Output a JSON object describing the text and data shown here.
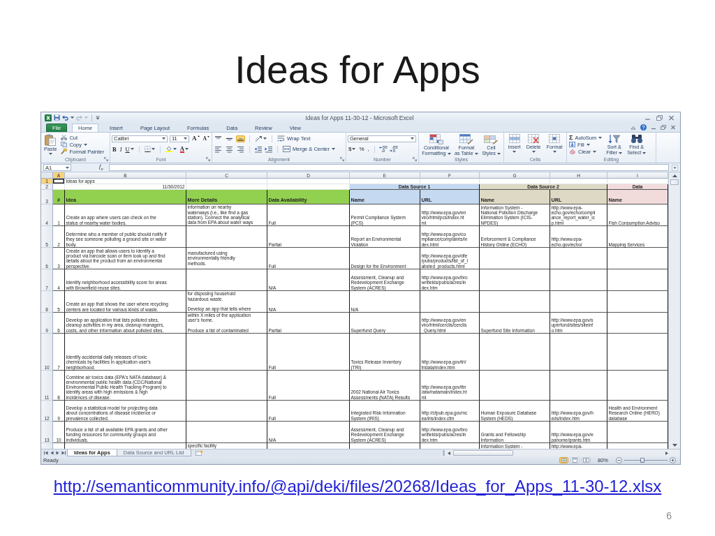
{
  "slide": {
    "title": "Ideas for Apps",
    "link": "http://semanticommunity.info/@api/deki/files/20268/Ideas_for_Apps_11-30-12.xlsx",
    "page_number": "6"
  },
  "window": {
    "title": "Ideas for Apps 11-30-12 - Microsoft Excel"
  },
  "quick_access": [
    {
      "kind": "save",
      "disabled": false
    },
    {
      "kind": "undo",
      "disabled": false
    },
    {
      "kind": "redo",
      "disabled": true
    }
  ],
  "ribbon_tabs": [
    {
      "label": "File",
      "kind": "file",
      "selected": false
    },
    {
      "label": "Home",
      "kind": "tab",
      "selected": true
    },
    {
      "label": "Insert",
      "kind": "tab",
      "selected": false
    },
    {
      "label": "Page Layout",
      "kind": "tab",
      "selected": false
    },
    {
      "label": "Formulas",
      "kind": "tab",
      "selected": false
    },
    {
      "label": "Data",
      "kind": "tab",
      "selected": false
    },
    {
      "label": "Review",
      "kind": "tab",
      "selected": false
    },
    {
      "label": "View",
      "kind": "tab",
      "selected": false
    }
  ],
  "ribbon_groups": [
    {
      "kind": "clipboard",
      "title": "Clipboard",
      "launcher": true,
      "paste": "Paste",
      "cut": "Cut",
      "copy": "Copy",
      "format_painter": "Format Painter"
    },
    {
      "kind": "font",
      "title": "Font",
      "launcher": true,
      "font_name": "Calibri",
      "font_size": "11",
      "grow": "A",
      "shrink": "A",
      "bold": "B",
      "italic": "I",
      "underline": "U",
      "font_color": "A"
    },
    {
      "kind": "alignment",
      "title": "Alignment",
      "launcher": true,
      "vertical_align": [
        {
          "selected": false
        },
        {
          "selected": false
        },
        {
          "selected": true
        }
      ],
      "wrap_text": "Wrap Text",
      "merge": "Merge & Center"
    },
    {
      "kind": "number",
      "title": "Number",
      "launcher": true,
      "format": "General",
      "currency": "$",
      "percent": "%",
      "comma": ","
    },
    {
      "kind": "styles",
      "title": "Styles",
      "buttons": [
        {
          "kind": "conditional",
          "label": "Conditional\nFormatting"
        },
        {
          "kind": "table",
          "label": "Format\nas Table"
        },
        {
          "kind": "cell_styles",
          "label": "Cell\nStyles"
        }
      ]
    },
    {
      "kind": "cells",
      "title": "Cells",
      "buttons": [
        {
          "kind": "insert",
          "label": "Insert"
        },
        {
          "kind": "delete",
          "label": "Delete"
        },
        {
          "kind": "format",
          "label": "Format"
        }
      ]
    },
    {
      "kind": "editing",
      "title": "Editing",
      "autosum_symbol": "Σ",
      "autosum": "AutoSum",
      "fill": "Fill",
      "clear": "Clear",
      "sort_filter": "Sort &\nFilter",
      "find_select": "Find &\nSelect"
    }
  ],
  "formula_bar": {
    "name_box": "A1",
    "function_label": "f$_{x}$"
  },
  "sheet": {
    "columns": [
      {
        "letter": "A",
        "selected": true
      },
      {
        "letter": "B",
        "selected": false
      },
      {
        "letter": "C",
        "selected": false
      },
      {
        "letter": "D",
        "selected": false
      },
      {
        "letter": "E",
        "selected": false
      },
      {
        "letter": "F",
        "selected": false
      },
      {
        "letter": "G",
        "selected": false
      },
      {
        "letter": "H",
        "selected": false
      },
      {
        "letter": "I",
        "selected": false
      }
    ],
    "title_row": {
      "row": "1",
      "selected": true,
      "title": "Ideas for apps"
    },
    "date_row": {
      "row": "2",
      "selected": false,
      "date": "11/30/2012"
    },
    "header_row": {
      "row": "3",
      "selected": false
    },
    "header_groups": [
      {
        "color": "#92d050",
        "columns": [
          "#",
          "Idea",
          "More Details",
          "Data Availability"
        ]
      },
      {
        "title": "Data Source 1",
        "color": "#c5d9f1",
        "columns": [
          "Name",
          "URL"
        ]
      },
      {
        "title": "Data Source 2",
        "color": "#ddd9c4",
        "columns": [
          "Name",
          "URL"
        ]
      },
      {
        "title": "Data",
        "color": "#f2dcdb",
        "columns": [
          "Name"
        ]
      }
    ],
    "rows": [
      {
        "row": "4",
        "selected": false,
        "number": "1",
        "idea": "Create an app where users can check on the\nstatus of nearby water bodies.",
        "details": "information on nearby\nwaterways (i.e., like find a gas\nstation). Connect the analytical\ndata from EPA about water ways",
        "availability": "Full",
        "source1_name": "Permit Compliance System\n(PCS)",
        "source1_url": "http://www.epa.gov/en\nviro/html/pcs/index.ht\nml",
        "source2_name": "Information System -\nNational Pollution Discharge\nElimination System (ICIS-\nNPDES)",
        "source2_url": "http://www.epa-\necho.gov/echo/compli\nance_report_water_ic\np.html",
        "source3_name": "Fish Consumption Adviso"
      },
      {
        "row": "5",
        "selected": false,
        "number": "2",
        "idea": "Determine who a member of public should notify if\nthey see someone polluting a ground site or water\nbody.",
        "availability": "Partial",
        "source1_name": "Report an Environmental\nViolation",
        "source1_url": "http://www.epa.gov/co\nmpliance/complaints/in\ndex.html",
        "source2_name": "Enforcement & Compliance\nHistory Online (ECHO)",
        "source2_url": "http://www.epa-\necho.gov/echo/",
        "source3_name": "Mapping Services"
      },
      {
        "row": "6",
        "selected": false,
        "number": "3",
        "idea": "Create an app that allows users to identify a\nproduct via barcode scan or item look up and find\ndetails about the product from an environmental\nperspective.",
        "details": "manufactured using\nenvironmentally friendly\nmethods.",
        "availability": "Full",
        "source1_name": "Design for the Environment",
        "source1_url": "http://www.epa.gov/dfe\n/pubs/products/list_of_l\nabeled_products.html"
      },
      {
        "row": "7",
        "selected": false,
        "number": "4",
        "idea": "Identify neighborhood accessibility score for areas\nwith Brownfield reuse sites.",
        "availability": "N/A",
        "source1_name": "Assessment, Cleanup and\nRedevelopment Exchange\nSystem (ACRES)",
        "source1_url": "http://www.epa.gov/bro\nwnfields/pubs/acres/in\ndex.htm"
      },
      {
        "row": "8",
        "selected": false,
        "number": "5",
        "idea": "Create an app that shows the user where recycling\ncenters are located for various kinds of waste.",
        "details": "for disposing household\nhazardous waste.\n\nDevelop an app that tells where",
        "availability": "N/A",
        "source1_name": "N/A"
      },
      {
        "row": "9",
        "selected": false,
        "number": "6",
        "idea": "Develop an application that lists polluted sites,\ncleanup activities in my area, cleanup managers,\ncosts, and other information about polluted sites.",
        "details": "within X miles of the application\nuser's home.\n\nProduce a list of contaminated",
        "availability": "Partial",
        "source1_name": "Superfund Query",
        "source1_url": "http://www.epa.gov/en\nviro/html/cerclis/cerclis\n_Query.html",
        "source2_name": "Superfund Site Information",
        "source2_url": "http://www.epa.gov/s\nuperfund/sites/siteinf\no.htm"
      },
      {
        "row": "10",
        "selected": false,
        "number": "7",
        "idea": "Identify accidental daily releases of toxic\nchemicals by facilities in application user's\nneighborhood.",
        "availability": "Full",
        "source1_name": "Toxics Release Inventory\n(TRI)",
        "source1_url": "http://www.epa.gov/tri/\ntridata/index.htm"
      },
      {
        "row": "11",
        "selected": false,
        "number": "8",
        "idea": "Combine air toxics data (EPA's NATA database) &\nenvironmental public health data (CDC/National\nEnvironmental Public Health Tracking Program) to\nidentify areas with high emissions & high\nincidences of disease.",
        "availability": "Full",
        "source1_name": "2002 National Air Toxics\nAssessments (NATA) Results",
        "source1_url": "http://www.epa.gov/ttn\n/atw/natamain/index.ht\nml"
      },
      {
        "row": "12",
        "selected": false,
        "number": "9",
        "idea": "Develop a statistical model for projecting data\nabout concentrations of disease incidence or\nprevalence collected.",
        "availability": "Full",
        "source1_name": "Integrated Risk Information\nSystem (IRIS)",
        "source1_url": "http://cfpub.epa.gov/nc\nea/iris/index.cfm",
        "source2_name": "Human Exposure Database\nSystem (HEDS)",
        "source2_url": "http://www.epa.gov/h\neds/index.htm",
        "source3_name": "Health and Environment\nResearch Online (HERO)\ndatabase"
      },
      {
        "row": "13",
        "selected": false,
        "number": "10",
        "idea": "Produce a list of all available EPA grants and other\nfunding resources for community groups and\nindividuals.",
        "availability": "N/A",
        "source1_name": "Assessment, Cleanup and\nRedevelopment Exchange\nSystem (ACRES)",
        "source1_url": "http://www.epa.gov/bro\nwnfields/pubs/acres/in\ndex.htm",
        "source2_name": "Grants and Fellowship\nInformation",
        "source2_url": "http://www.epa.gov/e\npahome/grants.htm"
      },
      {
        "selected": false,
        "details": "specific facility",
        "source2_name": "Information System -",
        "source2_url": "http://www.epa-"
      }
    ]
  },
  "sheet_tabs": [
    {
      "label": "Ideas for Apps",
      "selected": true
    },
    {
      "label": "Data Source and URL List",
      "selected": false
    }
  ],
  "status_bar": {
    "status": "Ready",
    "views": [
      {
        "kind": "normal",
        "selected": true
      },
      {
        "kind": "page_layout",
        "selected": false
      },
      {
        "kind": "page_break",
        "selected": false
      }
    ],
    "zoom": "80%",
    "zoom_slider": {
      "level": 0.42
    }
  }
}
